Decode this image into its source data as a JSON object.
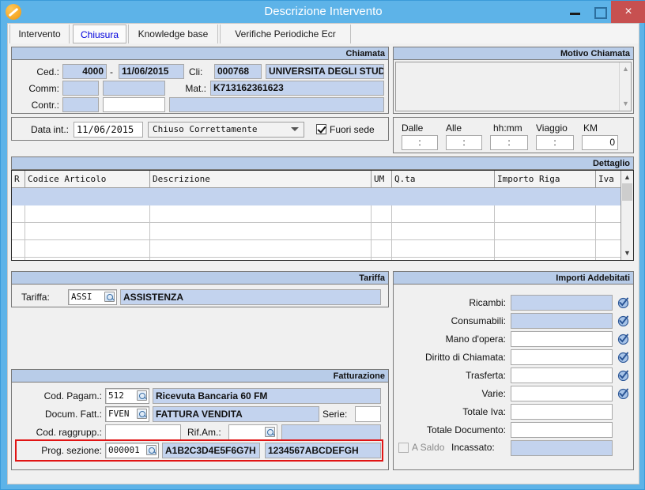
{
  "window": {
    "title": "Descrizione Intervento",
    "app_icon": "pencil-circle-icon",
    "minimize_label": "",
    "maximize_label": "",
    "close_label": "×",
    "accent_color": "#5db3e8",
    "close_color": "#c75050"
  },
  "tabs": [
    {
      "label": "Intervento",
      "selected": false
    },
    {
      "label": "Chiusura",
      "selected": true
    },
    {
      "label": "Knowledge base",
      "selected": false
    },
    {
      "label": "Verifiche Periodiche Ecr",
      "selected": false
    }
  ],
  "chiamata": {
    "title": "Chiamata",
    "ced_label": "Ced.:",
    "ced_value": "4000",
    "separator": "-",
    "ced_date": "11/06/2015",
    "cli_label": "Cli:",
    "cli_code": "000768",
    "cli_name": "UNIVERSITA DEGLI STUDI",
    "comm_label": "Comm:",
    "comm_code": "",
    "comm_name": "",
    "mat_label": "Mat.:",
    "mat_value": "K713162361623",
    "contr_label": "Contr.:",
    "contr_code": "",
    "contr_ref": "",
    "contr_desc": ""
  },
  "data_int": {
    "label": "Data int.:",
    "value": "11/06/2015",
    "status": "Chiuso Correttamente",
    "status_options": [
      "Chiuso Correttamente"
    ],
    "fuori_sede_label": "Fuori sede",
    "fuori_sede_checked": true
  },
  "motivo": {
    "title": "Motivo Chiamata",
    "text": ""
  },
  "tempi": {
    "dalle_label": "Dalle",
    "dalle_value": ":",
    "alle_label": "Alle",
    "alle_value": ":",
    "hhmm_label": "hh:mm",
    "hhmm_value": ":",
    "viaggio_label": "Viaggio",
    "viaggio_value": ":",
    "km_label": "KM",
    "km_value": "0"
  },
  "dettaglio": {
    "title": "Dettaglio",
    "columns": [
      "R",
      "Codice Articolo",
      "Descrizione",
      "UM",
      "Q.ta",
      "Importo Riga",
      "Iva"
    ],
    "rows": [
      {
        "selected": true,
        "cells": [
          "",
          "",
          "",
          "",
          "",
          "",
          ""
        ]
      },
      {
        "selected": false,
        "cells": [
          "",
          "",
          "",
          "",
          "",
          "",
          ""
        ]
      },
      {
        "selected": false,
        "cells": [
          "",
          "",
          "",
          "",
          "",
          "",
          ""
        ]
      },
      {
        "selected": false,
        "cells": [
          "",
          "",
          "",
          "",
          "",
          "",
          ""
        ]
      },
      {
        "selected": false,
        "cells": [
          "",
          "",
          "",
          "",
          "",
          "",
          ""
        ]
      }
    ],
    "scroll_up": "▲",
    "scroll_down": "▼"
  },
  "tariffa": {
    "title": "Tariffa",
    "label": "Tariffa:",
    "code": "ASSI",
    "description": "ASSISTENZA"
  },
  "fatturazione": {
    "title": "Fatturazione",
    "cod_pagam_label": "Cod. Pagam.:",
    "cod_pagam_code": "512",
    "cod_pagam_desc": "Ricevuta Bancaria 60 FM",
    "docum_fatt_label": "Docum. Fatt.:",
    "docum_fatt_code": "FVEN",
    "docum_fatt_desc": "FATTURA VENDITA",
    "serie_label": "Serie:",
    "serie_value": "",
    "cod_raggrupp_label": "Cod. raggrupp.:",
    "cod_raggrupp_value": "",
    "rif_am_label": "Rif.Am.:",
    "rif_am_code": "",
    "rif_am_desc": "",
    "prog_sezione_label": "Prog. sezione:",
    "prog_sezione_value": "000001",
    "prog_sezione_field2": "A1B2C3D4E5F6G7H",
    "prog_sezione_field3": "1234567ABCDEFGH",
    "highlight_color": "#e11414"
  },
  "importi": {
    "title": "Importi Addebitati",
    "rows": [
      {
        "label": "Ricambi:",
        "value": "",
        "readonly": true,
        "has_check": true
      },
      {
        "label": "Consumabili:",
        "value": "",
        "readonly": true,
        "has_check": true
      },
      {
        "label": "Mano d'opera:",
        "value": "",
        "readonly": false,
        "has_check": true
      },
      {
        "label": "Diritto di Chiamata:",
        "value": "",
        "readonly": false,
        "has_check": true
      },
      {
        "label": "Trasferta:",
        "value": "",
        "readonly": false,
        "has_check": true
      },
      {
        "label": "Varie:",
        "value": "",
        "readonly": false,
        "has_check": true
      },
      {
        "label": "Totale Iva:",
        "value": "",
        "readonly": false,
        "has_check": false
      },
      {
        "label": "Totale Documento:",
        "value": "",
        "readonly": false,
        "has_check": false
      }
    ],
    "a_saldo_label": "A Saldo",
    "a_saldo_checked": false,
    "incassato_label": "Incassato:",
    "incassato_value": ""
  }
}
